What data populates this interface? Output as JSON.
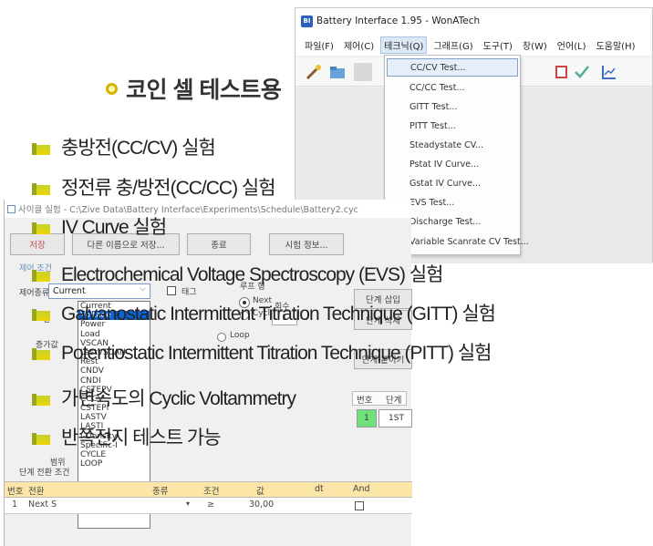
{
  "battery_window": {
    "title": "Battery Interface 1.95 - WonATech",
    "app_icon": "BI",
    "menus": [
      "파일(F)",
      "제어(C)",
      "테크닉(Q)",
      "그래프(G)",
      "도구(T)",
      "창(W)",
      "언어(L)",
      "도움말(H)"
    ],
    "technique_menu": [
      "CC/CV Test...",
      "CC/CC Test...",
      "GITT Test...",
      "PITT Test...",
      "Steadystate CV...",
      "Pstat IV Curve...",
      "Gstat IV Curve...",
      "EVS Test...",
      "Discharge Test...",
      "Variable Scanrate CV Test..."
    ]
  },
  "cycle_window": {
    "title": "사이클 실험 - C:\\Zive Data\\Battery Interface\\Experiments\\Schedule\\Battery2.cyc",
    "save": "저장",
    "save_as": "다른 이름으로 저장...",
    "exit": "종료",
    "start_info": "시험 정보...",
    "control_condition": "제어 조건",
    "control_type_label": "제어종류",
    "control_type_value": "Current",
    "tag_label": "태그",
    "loop_label": "루프 형",
    "loop_options": [
      "Next",
      "Cycle",
      "Loop"
    ],
    "count_label": "회수",
    "count_value": "1",
    "step_insert": "단계 삽입",
    "step_delete": "단계 삭제",
    "step_paste": "단계 붙이기",
    "mode_options": [
      "Current",
      "Voltage",
      "Power",
      "Load",
      "VSCAN",
      "LastVSCAN",
      "Rest",
      "CNDV",
      "CNDI",
      "CSTEPV",
      "CCCV",
      "CSTEPI",
      "LASTV",
      "LASTI",
      "I-Density",
      "Specific-I",
      "CYCLE",
      "LOOP"
    ],
    "step_table_headers": [
      "번호",
      "단계"
    ],
    "step_table_row": [
      "1",
      "1ST"
    ],
    "condition_section": "단계 전환 조건",
    "table_headers": [
      "번호",
      "전환",
      "종류",
      "조건",
      "값",
      "dt",
      "And"
    ],
    "table_row": [
      "1",
      "Next S",
      "",
      "≥",
      "30,00",
      "",
      ""
    ],
    "label_gi": "길",
    "label_increase": "증가값",
    "label_range": "범위"
  },
  "slide": {
    "heading": "코인 셀 테스트용",
    "bullets": [
      "충방전(CC/CV) 실험",
      "정전류 충/방전(CC/CC) 실험",
      "IV Curve 실험",
      "Electrochemical Voltage Spectroscopy (EVS) 실험",
      "Galvanostatic Intermittent Titration Technique (GITT) 실험",
      "Potentiostatic Intermittent Titration Technique (PITT) 실험",
      "가변속도의 Cyclic Voltammetry",
      "반쪽전지 테스트 가능"
    ]
  }
}
